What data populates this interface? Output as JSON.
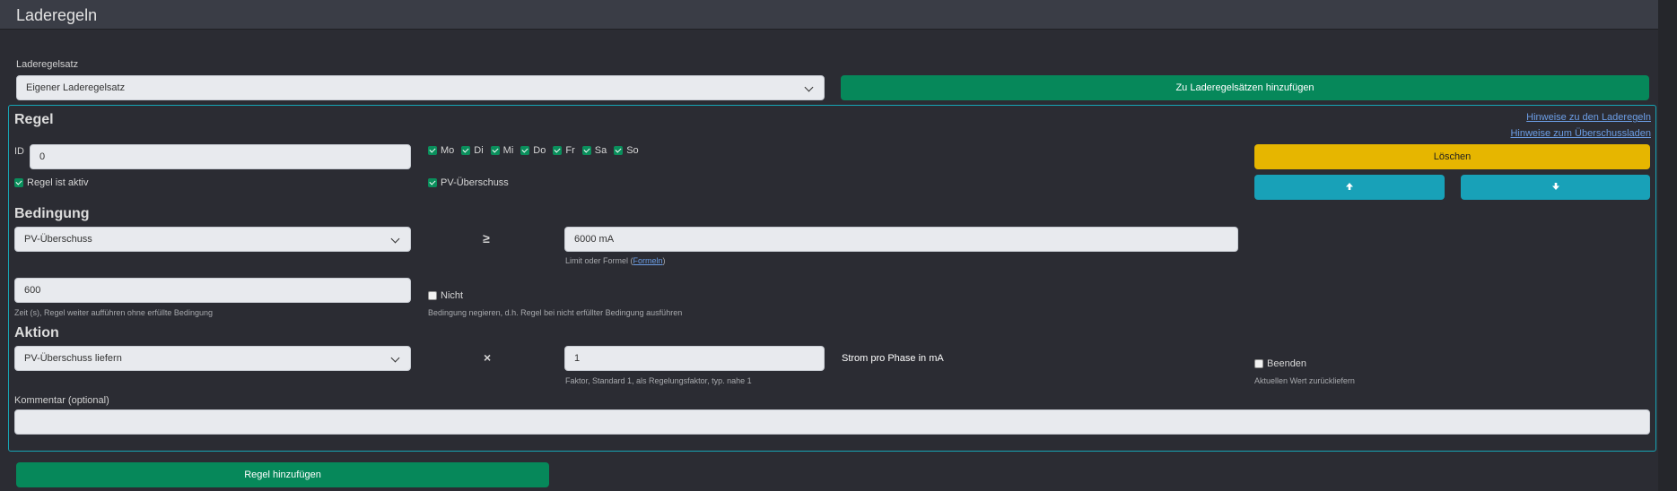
{
  "page": {
    "title": "Laderegeln"
  },
  "ruleset": {
    "label": "Laderegelsatz",
    "selected": "Eigener Laderegelsatz",
    "add_button": "Zu Laderegelsätzen hinzufügen"
  },
  "rule": {
    "heading": "Regel",
    "link_rules": "Hinweise zu den Laderegeln",
    "link_surplus": "Hinweise zum Überschussladen",
    "id_label": "ID",
    "id_value": "0",
    "days": [
      {
        "label": "Mo",
        "checked": true
      },
      {
        "label": "Di",
        "checked": true
      },
      {
        "label": "Mi",
        "checked": true
      },
      {
        "label": "Do",
        "checked": true
      },
      {
        "label": "Fr",
        "checked": true
      },
      {
        "label": "Sa",
        "checked": true
      },
      {
        "label": "So",
        "checked": true
      }
    ],
    "active_label": "Regel ist aktiv",
    "pv_label": "PV-Überschuss",
    "delete_button": "Löschen",
    "up_icon": "arrow-up-icon",
    "down_icon": "arrow-down-icon"
  },
  "condition": {
    "heading": "Bedingung",
    "selected": "PV-Überschuss",
    "operator": "≥",
    "limit_value": "6000 mA",
    "limit_help": "Limit oder Formel (",
    "limit_help_link": "Formeln",
    "limit_help_end": ")",
    "time_value": "600",
    "time_help": "Zeit (s), Regel weiter aufführen ohne erfüllte Bedingung",
    "negate_label": "Nicht",
    "negate_help": "Bedingung negieren, d.h. Regel bei nicht erfüllter Bedingung ausführen"
  },
  "action": {
    "heading": "Aktion",
    "selected": "PV-Überschuss liefern",
    "operator": "×",
    "factor_value": "1",
    "factor_help": "Faktor, Standard 1, als Regelungsfaktor, typ. nahe 1",
    "unit_label": "Strom pro Phase in mA",
    "end_label": "Beenden",
    "end_help": "Aktuellen Wert zurückliefern"
  },
  "comment": {
    "label": "Kommentar (optional)",
    "value": ""
  },
  "footer": {
    "add_rule_button": "Regel hinzufügen"
  },
  "colors": {
    "green": "#06885a",
    "yellow": "#e6b600",
    "teal": "#18a1b8",
    "panel_border": "#16a5b5"
  }
}
